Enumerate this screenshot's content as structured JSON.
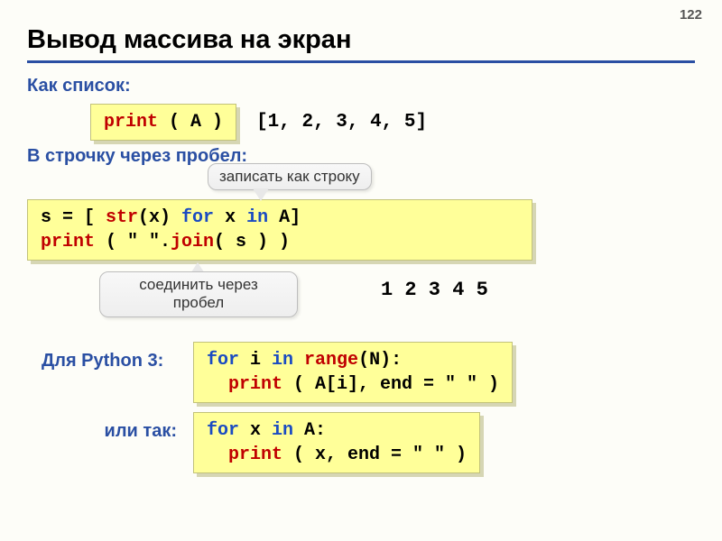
{
  "page_number": "122",
  "title": "Вывод массива на экран",
  "subhead_list": "Как список:",
  "code_print_A": {
    "print": "print",
    "paren_l": " ( ",
    "arg": "A",
    "paren_r": " )"
  },
  "output_list": "[1, 2, 3, 4, 5]",
  "subhead_line": "В строчку через пробел:",
  "callout_top": "записать как строку",
  "code_join": {
    "l1a": "s = [ ",
    "str": "str",
    "l1b": "(x) ",
    "for": "for",
    "l1c": " x ",
    "in": "in",
    "l1d": " A]",
    "l2a": "print",
    "l2b": " ( \" \".",
    "join": "join",
    "l2c": "( s ) )"
  },
  "callout_bottom_l1": "соединить через",
  "callout_bottom_l2": "пробел",
  "output_line": "1 2 3 4 5",
  "subhead_py3": "Для Python 3:",
  "code_for_range": {
    "for": "for",
    " i": " i ",
    "in": "in",
    " range": " range",
    "rest": "(N):",
    "l2a": "  print",
    "l2b": " ( A[i], end = \" \" )"
  },
  "label_or": "или так:",
  "code_for_x": {
    "for": "for",
    "mid": " x ",
    "in": "in",
    "end": " A:",
    "l2a": "  print",
    "l2b": " ( x, end = \" \" )"
  }
}
